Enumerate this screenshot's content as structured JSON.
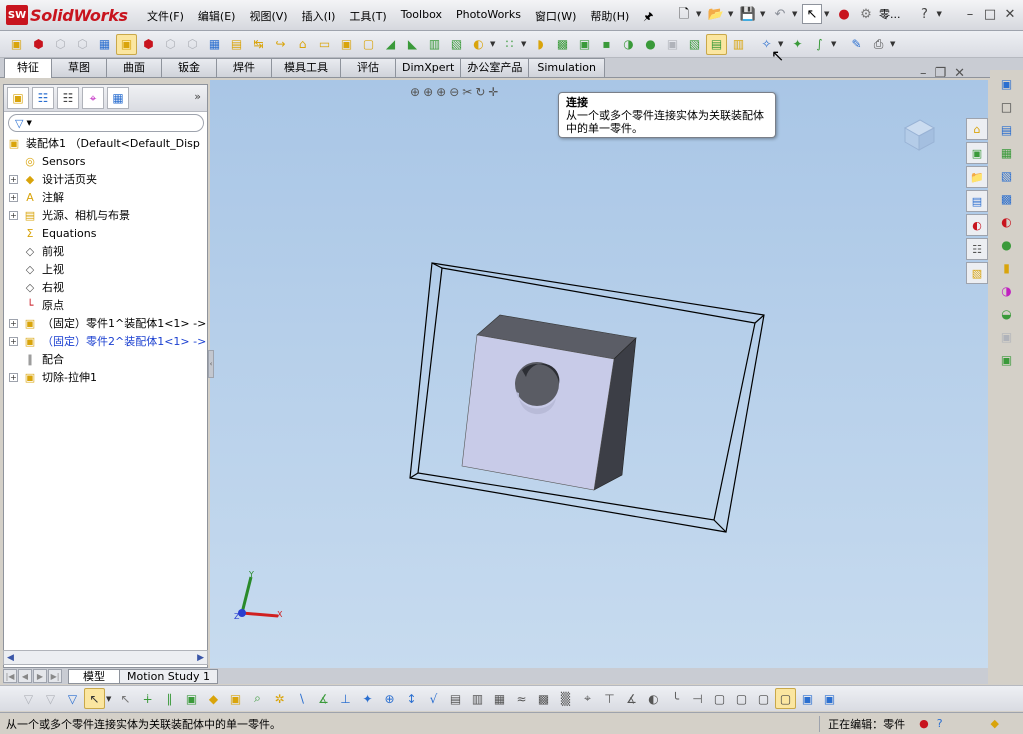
{
  "app": {
    "brand": "SolidWorks",
    "brand_badge": "SW"
  },
  "menu": [
    "文件(F)",
    "编辑(E)",
    "视图(V)",
    "插入(I)",
    "工具(T)",
    "Toolbox",
    "PhotoWorks",
    "窗口(W)",
    "帮助(H)"
  ],
  "quick_access": {
    "document_label": "零...",
    "help": "?"
  },
  "command_tabs": [
    "特征",
    "草图",
    "曲面",
    "钣金",
    "焊件",
    "模具工具",
    "评估",
    "DimXpert",
    "办公室产品",
    "Simulation"
  ],
  "active_tab": "特征",
  "tooltip": {
    "title": "连接",
    "body": "从一个或多个零件连接实体为关联装配体中的单一零件。"
  },
  "tree": {
    "root": "装配体1 （Default<Default_Disp",
    "items": [
      {
        "label": "Sensors",
        "icon": "sensor-icon",
        "expand": false
      },
      {
        "label": "设计活页夹",
        "icon": "design-binder-icon",
        "expand": true
      },
      {
        "label": "注解",
        "icon": "annotations-icon",
        "expand": true
      },
      {
        "label": "光源、相机与布景",
        "icon": "lights-cameras-icon",
        "expand": true
      },
      {
        "label": "Equations",
        "icon": "equations-icon",
        "expand": false
      },
      {
        "label": "前视",
        "icon": "plane-icon",
        "expand": false
      },
      {
        "label": "上视",
        "icon": "plane-icon",
        "expand": false
      },
      {
        "label": "右视",
        "icon": "plane-icon",
        "expand": false
      },
      {
        "label": "原点",
        "icon": "origin-icon",
        "expand": false
      },
      {
        "label": "（固定）零件1^装配体1<1> ->",
        "icon": "part-icon",
        "expand": true
      },
      {
        "label": "（固定）零件2^装配体1<1> ->",
        "icon": "part-icon",
        "expand": true,
        "highlight": true
      },
      {
        "label": "配合",
        "icon": "mates-icon",
        "expand": false
      },
      {
        "label": "切除-拉伸1",
        "icon": "cut-extrude-icon",
        "expand": true
      }
    ]
  },
  "bottom_tabs": [
    "模型",
    "Motion Study 1"
  ],
  "status": {
    "message": "从一个或多个零件连接实体为关联装配体中的单一零件。",
    "editing": "正在编辑：零件"
  },
  "triad": {
    "x": "X",
    "y": "Y",
    "z": "Z"
  },
  "colors": {
    "viewport_top": "#a9c6e6",
    "highlight_tree": "#1a3fd0",
    "brand_red": "#c8141e"
  }
}
